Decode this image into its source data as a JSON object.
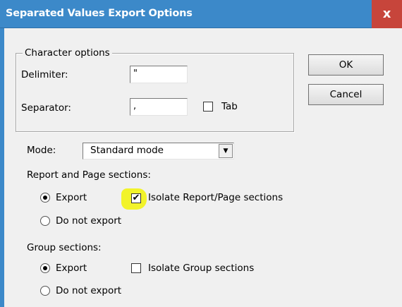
{
  "window": {
    "title": "Separated Values Export Options",
    "close_glyph": "x"
  },
  "character_options": {
    "legend": "Character options",
    "delimiter_label": "Delimiter:",
    "delimiter_value": "\"",
    "separator_label": "Separator:",
    "separator_value": ",",
    "tab_label": "Tab",
    "tab_checked": false
  },
  "buttons": {
    "ok": "OK",
    "cancel": "Cancel"
  },
  "mode": {
    "label": "Mode:",
    "value": "Standard mode"
  },
  "report_page": {
    "heading": "Report and Page sections:",
    "export_label": "Export",
    "do_not_export_label": "Do not export",
    "selected": "export",
    "isolate_label": "Isolate Report/Page sections",
    "isolate_checked": true,
    "check_glyph": "✔"
  },
  "group": {
    "heading": "Group sections:",
    "export_label": "Export",
    "do_not_export_label": "Do not export",
    "selected": "export",
    "isolate_label": "Isolate Group sections",
    "isolate_checked": false
  },
  "colors": {
    "titlebar": "#3c89c9",
    "close": "#c7453b",
    "highlight": "#f2f32a"
  },
  "icons": {
    "close": "close-icon",
    "dropdown": "chevron-down-icon"
  }
}
